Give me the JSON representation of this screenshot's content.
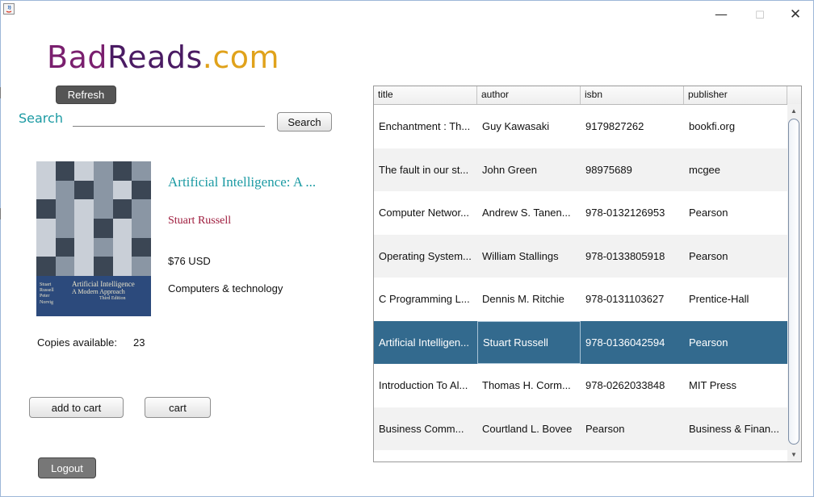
{
  "window": {
    "icon": "java-icon",
    "controls": {
      "minimize": "—",
      "maximize": "☐",
      "close": "✕"
    }
  },
  "logo": {
    "part1": "Bad",
    "part2": "Reads",
    "part3": ".com",
    "colors": [
      "#7a1f6e",
      "#4a1b63",
      "#e0a21b"
    ]
  },
  "toolbar": {
    "refresh_label": "Refresh"
  },
  "search": {
    "label": "Search",
    "button_label": "Search",
    "value": ""
  },
  "book": {
    "cover": {
      "authors": [
        "Stuart",
        "Russell",
        "Peter",
        "Norvig"
      ],
      "title_line1": "Artificial Intelligence",
      "title_line2": "A Modern Approach",
      "edition": "Third Edition"
    },
    "title": "Artificial Intelligence: A ...",
    "author": "Stuart Russell",
    "price": "$76 USD",
    "category": "Computers & technology",
    "copies_label": "Copies available:",
    "copies_value": "23"
  },
  "actions": {
    "add_to_cart_label": "add to cart",
    "cart_label": "cart",
    "logout_label": "Logout"
  },
  "table": {
    "columns": [
      "title",
      "author",
      "isbn",
      "publisher"
    ],
    "selected_row": 5,
    "rows": [
      [
        "Enchantment : Th...",
        "Guy Kawasaki",
        "9179827262",
        "bookfi.org"
      ],
      [
        "The fault in our st...",
        "John Green",
        "98975689",
        "mcgee"
      ],
      [
        "Computer Networ...",
        "Andrew S. Tanen...",
        "978-0132126953",
        "Pearson"
      ],
      [
        "Operating System...",
        "William Stallings",
        "978-0133805918",
        "Pearson"
      ],
      [
        "C Programming L...",
        "Dennis M. Ritchie",
        "978-0131103627",
        "Prentice-Hall"
      ],
      [
        "Artificial Intelligen...",
        "Stuart Russell",
        "978-0136042594",
        "Pearson"
      ],
      [
        "Introduction To Al...",
        "Thomas H. Corm...",
        "978-0262033848",
        "MIT Press"
      ],
      [
        "Business Comm...",
        "Courtland L. Bovee",
        "Pearson",
        "Business & Finan..."
      ]
    ]
  },
  "colors": {
    "accent": "#1b9aa3",
    "author": "#9e1b3c",
    "selection": "#336a8e"
  }
}
